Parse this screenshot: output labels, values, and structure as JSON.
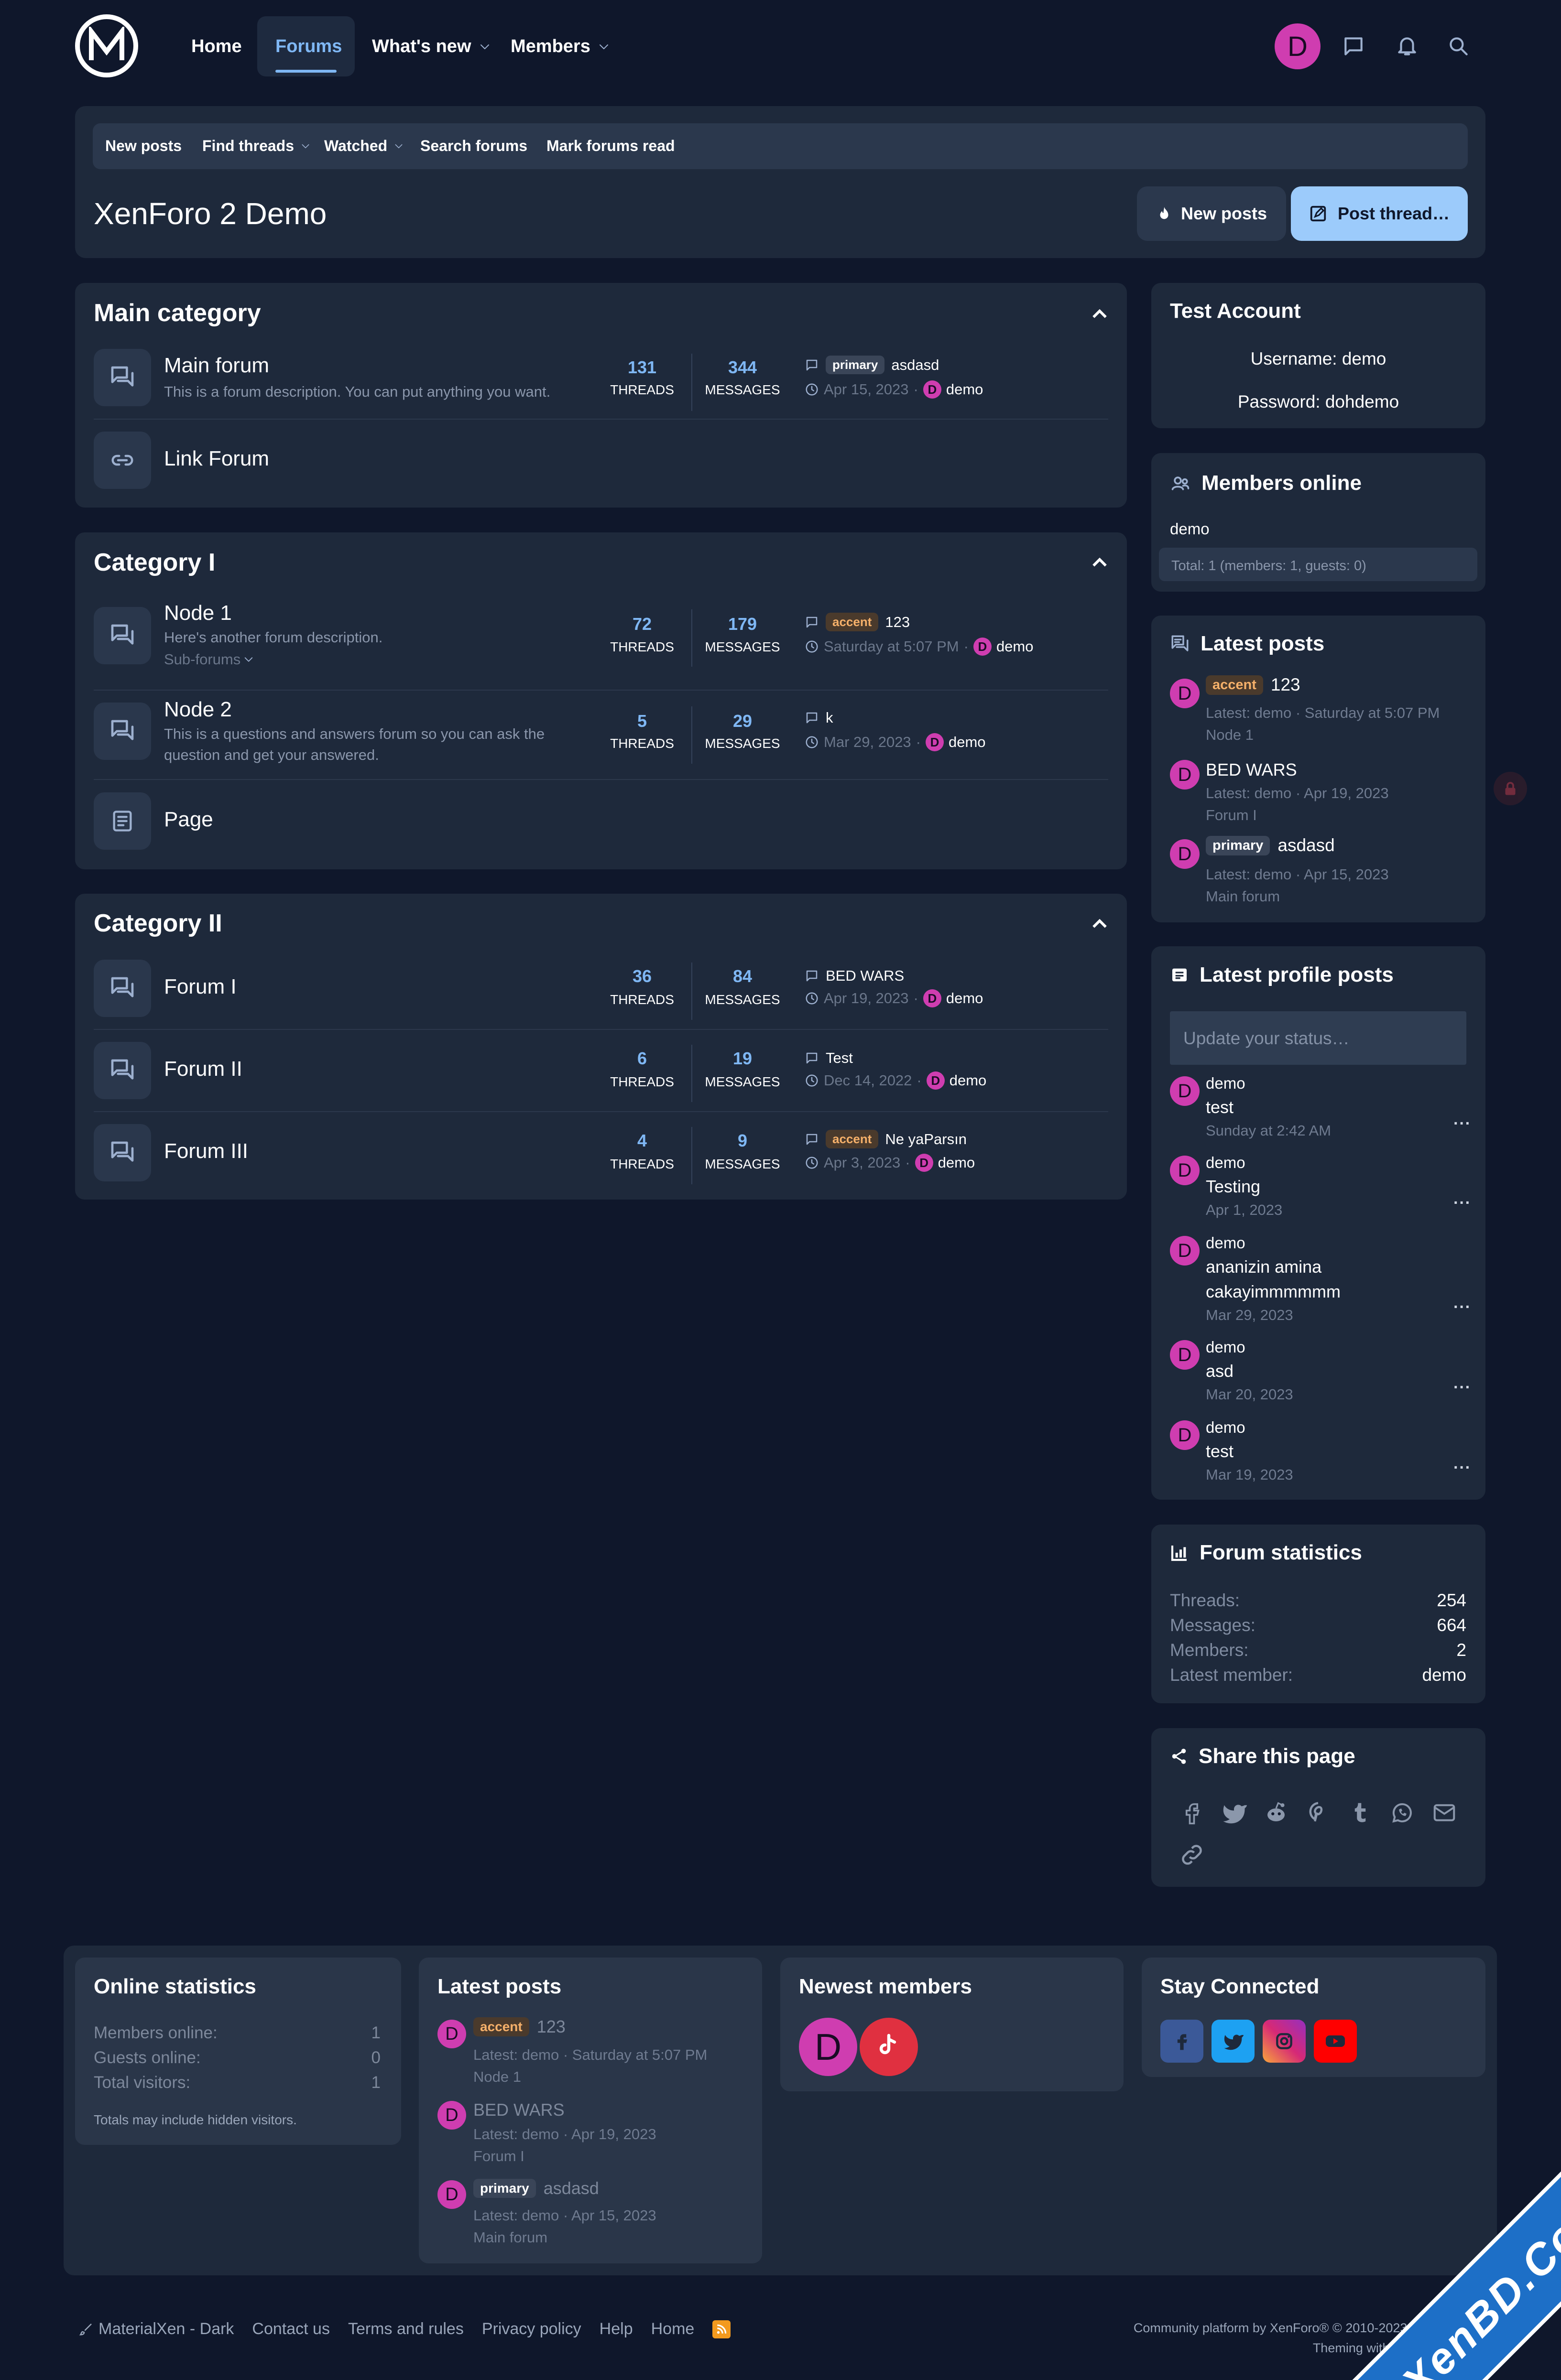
{
  "header": {
    "nav": {
      "home": "Home",
      "forums": "Forums",
      "whats_new": "What's new",
      "members": "Members"
    },
    "avatar_letter": "D"
  },
  "subnav": {
    "new_posts": "New posts",
    "find_threads": "Find threads",
    "watched": "Watched",
    "search_forums": "Search forums",
    "mark_read": "Mark forums read"
  },
  "page": {
    "title": "XenForo 2 Demo",
    "btn_new_posts": "New posts",
    "btn_post_thread": "Post thread…"
  },
  "labels": {
    "threads": "THREADS",
    "messages": "MESSAGES"
  },
  "categories": [
    {
      "title": "Main category",
      "nodes": [
        {
          "title": "Main forum",
          "desc": "This is a forum description. You can put anything you want.",
          "threads": "131",
          "messages": "344",
          "tag": "primary",
          "last_title": "asdasd",
          "last_date": "Apr 15, 2023",
          "last_user": "demo"
        },
        {
          "title": "Link Forum"
        }
      ]
    },
    {
      "title": "Category I",
      "nodes": [
        {
          "title": "Node 1",
          "desc": "Here's another forum description.",
          "subforums": "Sub-forums",
          "threads": "72",
          "messages": "179",
          "tag": "accent",
          "last_title": "123",
          "last_date": "Saturday at 5:07 PM",
          "last_user": "demo"
        },
        {
          "title": "Node 2",
          "desc": "This is a questions and answers forum so you can ask the question and get your answered.",
          "threads": "5",
          "messages": "29",
          "last_title": "k",
          "last_date": "Mar 29, 2023",
          "last_user": "demo"
        },
        {
          "title": "Page"
        }
      ]
    },
    {
      "title": "Category II",
      "nodes": [
        {
          "title": "Forum I",
          "threads": "36",
          "messages": "84",
          "last_title": "BED WARS",
          "last_date": "Apr 19, 2023",
          "last_user": "demo"
        },
        {
          "title": "Forum II",
          "threads": "6",
          "messages": "19",
          "last_title": "Test",
          "last_date": "Dec 14, 2022",
          "last_user": "demo"
        },
        {
          "title": "Forum III",
          "threads": "4",
          "messages": "9",
          "tag": "accent",
          "last_title": "Ne yaParsın",
          "last_date": "Apr 3, 2023",
          "last_user": "demo"
        }
      ]
    }
  ],
  "sidebar": {
    "test_account": {
      "title": "Test Account",
      "username": "Username: demo",
      "password": "Password: dohdemo"
    },
    "members_online": {
      "title": "Members online",
      "user": "demo",
      "total": "Total: 1 (members: 1, guests: 0)"
    },
    "latest_posts": {
      "title": "Latest posts",
      "items": [
        {
          "tag": "accent",
          "title": "123",
          "meta": "Latest: demo · Saturday at 5:07 PM",
          "forum": "Node 1"
        },
        {
          "title": "BED WARS",
          "meta": "Latest: demo · Apr 19, 2023",
          "forum": "Forum I"
        },
        {
          "tag": "primary",
          "title": "asdasd",
          "meta": "Latest: demo · Apr 15, 2023",
          "forum": "Main forum"
        }
      ]
    },
    "profile_posts": {
      "title": "Latest profile posts",
      "placeholder": "Update your status…",
      "items": [
        {
          "user": "demo",
          "text": "test",
          "date": "Sunday at 2:42 AM"
        },
        {
          "user": "demo",
          "text": "Testing",
          "date": "Apr 1, 2023"
        },
        {
          "user": "demo",
          "text": "ananizin amina",
          "text2": "cakayimmmmmm",
          "date": "Mar 29, 2023"
        },
        {
          "user": "demo",
          "text": "asd",
          "date": "Mar 20, 2023"
        },
        {
          "user": "demo",
          "text": "test",
          "date": "Mar 19, 2023"
        }
      ]
    },
    "forum_stats": {
      "title": "Forum statistics",
      "rows": [
        {
          "k": "Threads:",
          "v": "254"
        },
        {
          "k": "Messages:",
          "v": "664"
        },
        {
          "k": "Members:",
          "v": "2"
        },
        {
          "k": "Latest member:",
          "v": "demo"
        }
      ]
    },
    "share": {
      "title": "Share this page",
      "icons": [
        "facebook-icon",
        "twitter-icon",
        "reddit-icon",
        "pinterest-icon",
        "tumblr-icon",
        "whatsapp-icon",
        "email-icon",
        "link-icon"
      ]
    }
  },
  "footer_widgets": {
    "online": {
      "title": "Online statistics",
      "rows": [
        {
          "k": "Members online:",
          "v": "1"
        },
        {
          "k": "Guests online:",
          "v": "0"
        },
        {
          "k": "Total visitors:",
          "v": "1"
        }
      ],
      "note": "Totals may include hidden visitors."
    },
    "latest": {
      "title": "Latest posts"
    },
    "newest": {
      "title": "Newest members"
    },
    "stay": {
      "title": "Stay Connected",
      "colors": {
        "facebook": "#3b5998",
        "twitter": "#1da1f2",
        "instagram": "#c13584",
        "youtube": "#ff0000"
      }
    }
  },
  "footer": {
    "style": "MaterialXen - Dark",
    "links": [
      "Contact us",
      "Terms and rules",
      "Privacy policy",
      "Help",
      "Home"
    ],
    "copyright": "Community platform by XenForo® © 2010-2023 XenForo Ltd.",
    "theming": "Theming with ♥ by DohTheme"
  },
  "watermark": "XenBD.Com",
  "colors": {
    "bg": "#0f172b",
    "card": "#1e293b",
    "accent_blue": "#7fb7f4",
    "avatar": "#cf3db0",
    "post_button": "#9ccbfb"
  }
}
